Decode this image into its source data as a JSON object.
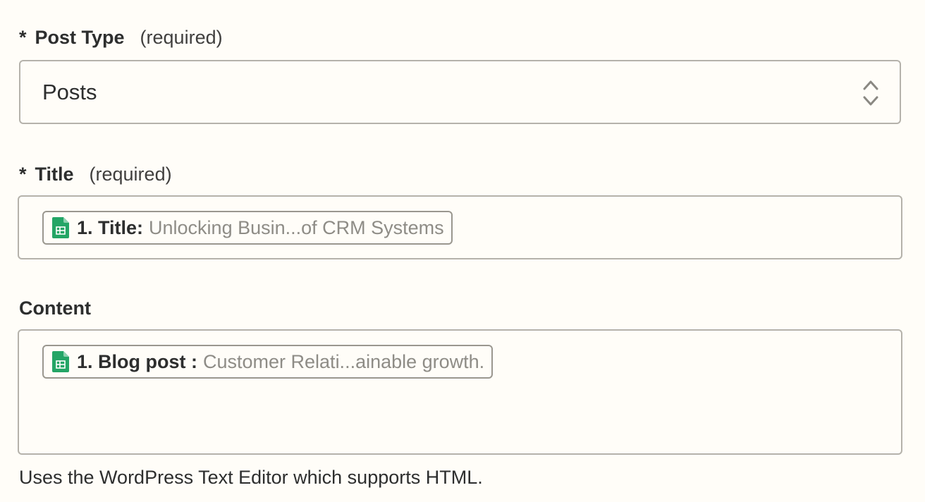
{
  "post_type": {
    "asterisk": "*",
    "label": "Post Type",
    "required_text": "(required)",
    "value": "Posts"
  },
  "title_field": {
    "asterisk": "*",
    "label": "Title",
    "required_text": "(required)",
    "pill": {
      "icon": "google-sheets-icon",
      "key": "1. Title:",
      "value": "Unlocking Busin...of CRM Systems"
    }
  },
  "content_field": {
    "label": "Content",
    "pill": {
      "icon": "google-sheets-icon",
      "key": "1. Blog post :",
      "value": "Customer Relati...ainable growth."
    },
    "helper_text": "Uses the WordPress Text Editor which supports HTML."
  },
  "colors": {
    "background": "#fffdf8",
    "border": "#b5b2ab",
    "sheets_green": "#23a566",
    "muted_text": "#8e8c86"
  }
}
